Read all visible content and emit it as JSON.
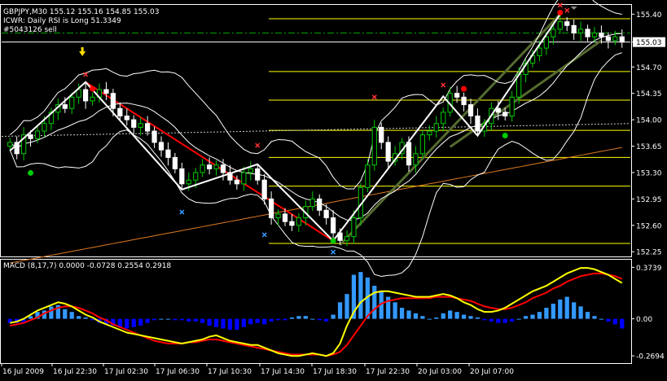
{
  "header": {
    "symbol_line": "GBPJPY,M30  155.12 155.16 154.85 155.03",
    "indicator_line": "ICWR: Daily RSI is Long 51.3349",
    "ticket_line": "#5043126 sell"
  },
  "macd_header": "MACD (8,17,7) 0.0000 -0.0728 0.2554 0.2918",
  "colors": {
    "background": "#000000",
    "grid": "#ffffff",
    "bull_candle": "#000000",
    "bear_candle": "#ffffff",
    "bull_outline": "#00cc00",
    "bollinger": "#ffffff",
    "zigzag": "#ffffff",
    "trend_down": "#ff0000",
    "trend_up": "#556b2f",
    "ma_long": "#e07a20",
    "fib_level": "#ffff00",
    "ask_line": "#00aa00",
    "macd_hist": "#0000ff",
    "macd_hist_pos": "#3399ff",
    "macd_main": "#ffff00",
    "macd_signal": "#ff0000",
    "marker_x": "#ff3333",
    "marker_blue": "#3399ff",
    "dot_green": "#00cc00",
    "dot_red": "#ff0000",
    "arrow": "#ffdd00"
  },
  "chart_data": {
    "type": "candlestick",
    "symbol": "GBPJPY",
    "timeframe": "M30",
    "y_ticks": [
      "155.40",
      "155.03",
      "154.70",
      "154.35",
      "154.00",
      "153.65",
      "153.30",
      "152.95",
      "152.60",
      "152.25"
    ],
    "y_tick_values": [
      155.4,
      155.03,
      154.7,
      154.35,
      154.0,
      153.65,
      153.3,
      152.95,
      152.6,
      152.25
    ],
    "ylim": [
      152.22,
      155.48
    ],
    "current_price": 155.03,
    "x_ticks": [
      "16 Jul 2009",
      "16 Jul 22:30",
      "17 Jul 02:30",
      "17 Jul 06:30",
      "17 Jul 10:30",
      "17 Jul 14:30",
      "17 Jul 18:30",
      "17 Jul 22:30",
      "20 Jul 03:00",
      "20 Jul 07:00"
    ],
    "close": [
      153.7,
      153.55,
      153.8,
      153.75,
      153.85,
      153.95,
      154.1,
      154.2,
      154.15,
      154.3,
      154.4,
      154.25,
      154.3,
      154.4,
      154.35,
      154.15,
      154.05,
      154.0,
      153.9,
      153.95,
      153.85,
      153.7,
      153.6,
      153.5,
      153.35,
      153.15,
      153.2,
      153.3,
      153.4,
      153.35,
      153.4,
      153.3,
      153.2,
      153.15,
      153.3,
      153.35,
      153.2,
      152.95,
      152.7,
      152.75,
      152.65,
      152.6,
      152.7,
      152.85,
      152.95,
      152.8,
      152.7,
      152.5,
      152.4,
      152.45,
      152.7,
      153.1,
      153.4,
      153.9,
      153.7,
      153.45,
      153.55,
      153.7,
      153.4,
      153.55,
      153.8,
      153.85,
      153.95,
      154.1,
      154.35,
      154.3,
      154.2,
      154.05,
      153.85,
      153.95,
      154.15,
      154.1,
      154.05,
      154.3,
      154.6,
      154.75,
      154.85,
      154.95,
      155.1,
      155.2,
      155.3,
      155.25,
      155.15,
      155.2,
      155.1,
      155.15,
      155.1,
      155.05,
      155.1,
      155.03
    ],
    "fib_levels": [
      155.34,
      154.64,
      154.26,
      153.86,
      153.5,
      153.12,
      152.36
    ],
    "macd_y_ticks": [
      "0.3739",
      "0.00",
      "-0.2694"
    ],
    "macd_y_tick_values": [
      0.3739,
      0.0,
      -0.2694
    ],
    "macd_ylim": [
      -0.31,
      0.4
    ],
    "macd_hist": [
      -0.03,
      -0.03,
      -0.03,
      0.02,
      0.05,
      0.06,
      0.09,
      0.1,
      0.07,
      0.05,
      0.02,
      0.01,
      -0.01,
      -0.03,
      -0.04,
      -0.05,
      -0.06,
      -0.07,
      -0.06,
      -0.05,
      -0.03,
      -0.01,
      0.0,
      0.0,
      -0.01,
      -0.01,
      -0.02,
      -0.02,
      -0.03,
      -0.05,
      -0.06,
      -0.07,
      -0.08,
      -0.08,
      -0.06,
      -0.04,
      -0.03,
      -0.04,
      -0.02,
      -0.01,
      -0.01,
      0.01,
      0.02,
      0.02,
      0.0,
      -0.01,
      -0.02,
      0.03,
      0.12,
      0.18,
      0.32,
      0.34,
      0.3,
      0.24,
      0.2,
      0.16,
      0.12,
      0.08,
      0.06,
      0.04,
      0.02,
      0.0,
      0.01,
      0.04,
      0.06,
      0.05,
      0.03,
      0.02,
      0.01,
      -0.01,
      -0.02,
      -0.03,
      -0.03,
      -0.02,
      0.0,
      0.02,
      0.03,
      0.05,
      0.08,
      0.11,
      0.14,
      0.16,
      0.12,
      0.09,
      0.05,
      0.02,
      0.0,
      -0.02,
      -0.04,
      -0.07
    ],
    "macd_main": [
      -0.03,
      -0.02,
      0.0,
      0.03,
      0.06,
      0.08,
      0.1,
      0.12,
      0.11,
      0.09,
      0.06,
      0.03,
      0.01,
      -0.02,
      -0.04,
      -0.06,
      -0.08,
      -0.1,
      -0.11,
      -0.12,
      -0.13,
      -0.14,
      -0.15,
      -0.16,
      -0.17,
      -0.18,
      -0.17,
      -0.16,
      -0.15,
      -0.13,
      -0.12,
      -0.14,
      -0.16,
      -0.17,
      -0.18,
      -0.19,
      -0.19,
      -0.21,
      -0.23,
      -0.25,
      -0.26,
      -0.27,
      -0.27,
      -0.26,
      -0.25,
      -0.26,
      -0.27,
      -0.25,
      -0.18,
      -0.05,
      0.05,
      0.12,
      0.16,
      0.19,
      0.2,
      0.2,
      0.19,
      0.18,
      0.17,
      0.16,
      0.16,
      0.16,
      0.17,
      0.18,
      0.17,
      0.15,
      0.12,
      0.1,
      0.07,
      0.05,
      0.05,
      0.06,
      0.08,
      0.11,
      0.14,
      0.17,
      0.2,
      0.22,
      0.24,
      0.27,
      0.3,
      0.33,
      0.35,
      0.37,
      0.37,
      0.36,
      0.34,
      0.32,
      0.29,
      0.26
    ],
    "macd_signal": [
      -0.05,
      -0.04,
      -0.03,
      -0.01,
      0.01,
      0.04,
      0.06,
      0.08,
      0.09,
      0.09,
      0.08,
      0.06,
      0.04,
      0.01,
      -0.01,
      -0.04,
      -0.06,
      -0.08,
      -0.1,
      -0.12,
      -0.14,
      -0.16,
      -0.17,
      -0.18,
      -0.18,
      -0.18,
      -0.17,
      -0.17,
      -0.16,
      -0.15,
      -0.15,
      -0.16,
      -0.17,
      -0.18,
      -0.19,
      -0.2,
      -0.21,
      -0.22,
      -0.23,
      -0.24,
      -0.25,
      -0.26,
      -0.26,
      -0.26,
      -0.26,
      -0.26,
      -0.27,
      -0.26,
      -0.24,
      -0.19,
      -0.12,
      -0.05,
      0.02,
      0.07,
      0.11,
      0.13,
      0.14,
      0.15,
      0.15,
      0.15,
      0.15,
      0.15,
      0.16,
      0.16,
      0.16,
      0.15,
      0.14,
      0.13,
      0.11,
      0.09,
      0.08,
      0.07,
      0.07,
      0.08,
      0.1,
      0.12,
      0.15,
      0.17,
      0.19,
      0.22,
      0.24,
      0.27,
      0.29,
      0.31,
      0.32,
      0.33,
      0.33,
      0.32,
      0.31,
      0.29
    ]
  }
}
